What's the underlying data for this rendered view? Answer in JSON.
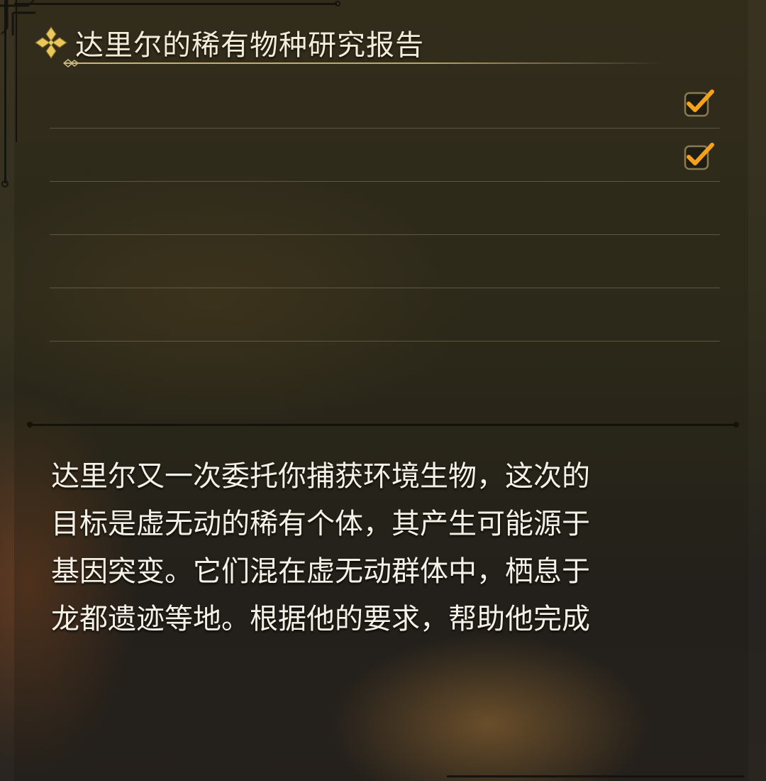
{
  "quest": {
    "title": "达里尔的稀有物种研究报告",
    "title_icon": "quest-ornament-icon",
    "objectives": [
      {
        "text": "",
        "completed": true
      },
      {
        "text": "",
        "completed": true
      },
      {
        "text": "",
        "completed": false
      },
      {
        "text": "",
        "completed": false
      },
      {
        "text": "",
        "completed": false
      }
    ],
    "description_lines": [
      "达里尔又一次委托你捕获环境生物，这次的",
      "目标是虚无动的稀有个体，其产生可能源于",
      "基因突变。它们混在虚无动群体中，栖息于",
      "龙都遗迹等地。根据他的要求，帮助他完成"
    ]
  },
  "colors": {
    "accent_gold": "#e9c75a",
    "check_orange": "#f5a11a",
    "text_main": "#f6f1e6"
  }
}
